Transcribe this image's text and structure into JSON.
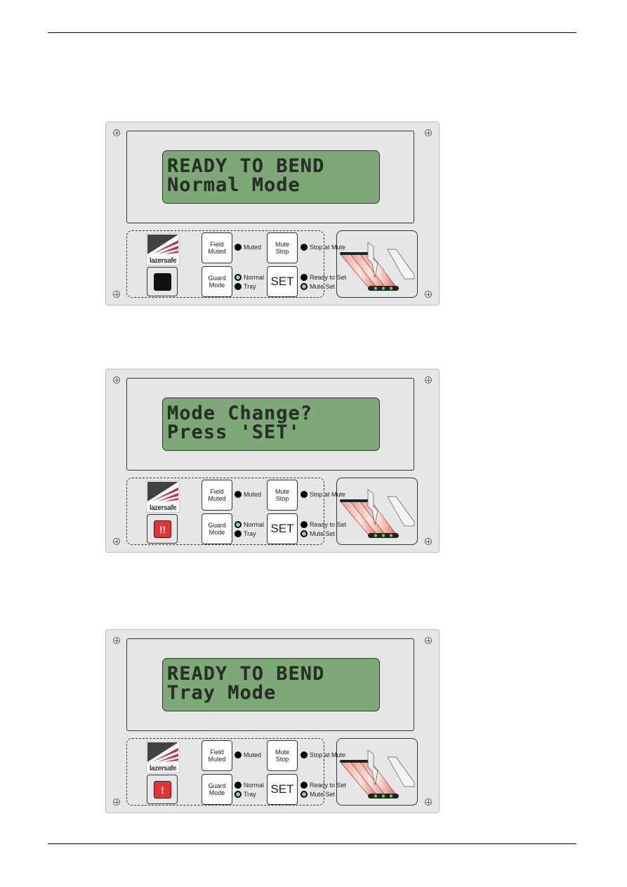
{
  "page": {
    "header_rule": true,
    "footer_rule": true
  },
  "brand": {
    "logo_text": "lazersafe",
    "logo_colors": {
      "dark": "#3f4440",
      "red": "#d8242f"
    }
  },
  "colors": {
    "lcd": "#7fa878",
    "panel": "#e6e6e6",
    "led_on": "#7be36e",
    "alarm": "#e53232"
  },
  "panels": [
    {
      "lcd": {
        "line1": "READY TO BEND",
        "line2": "Normal Mode"
      },
      "alarm": {
        "state": "off",
        "symbol": ""
      },
      "buttons": {
        "field_muted": [
          "Field",
          "Muted"
        ],
        "mute_stop": [
          "Mute",
          "Stop"
        ],
        "guard_mode": [
          "Guard",
          "Mode"
        ],
        "set": "SET"
      },
      "indicators": [
        {
          "label": "Muted",
          "on": false
        },
        {
          "label": "Stop at Mute",
          "on": false
        },
        {
          "label": "Normal",
          "on": true
        },
        {
          "label": "Tray",
          "on": false
        },
        {
          "label": "Ready to Set",
          "on": false
        },
        {
          "label": "Mute Set",
          "on": true
        }
      ]
    },
    {
      "lcd": {
        "line1": "Mode Change?",
        "line2": "Press 'SET'"
      },
      "alarm": {
        "state": "on",
        "symbol": "!!"
      },
      "buttons": {
        "field_muted": [
          "Field",
          "Muted"
        ],
        "mute_stop": [
          "Mute",
          "Stop"
        ],
        "guard_mode": [
          "Guard",
          "Mode"
        ],
        "set": "SET"
      },
      "indicators": [
        {
          "label": "Muted",
          "on": false
        },
        {
          "label": "Stop at Mute",
          "on": false
        },
        {
          "label": "Normal",
          "on": true
        },
        {
          "label": "Tray",
          "on": false
        },
        {
          "label": "Ready to Set",
          "on": false
        },
        {
          "label": "Mute Set",
          "on": true
        }
      ]
    },
    {
      "lcd": {
        "line1": "READY TO BEND",
        "line2": "Tray Mode"
      },
      "alarm": {
        "state": "on",
        "symbol": "!"
      },
      "buttons": {
        "field_muted": [
          "Field",
          "Muted"
        ],
        "mute_stop": [
          "Mute",
          "Stop"
        ],
        "guard_mode": [
          "Guard",
          "Mode"
        ],
        "set": "SET"
      },
      "indicators": [
        {
          "label": "Muted",
          "on": false
        },
        {
          "label": "Stop at Mute",
          "on": false
        },
        {
          "label": "Normal",
          "on": false
        },
        {
          "label": "Tray",
          "on": true
        },
        {
          "label": "Ready to Set",
          "on": false
        },
        {
          "label": "Mute Set",
          "on": true
        }
      ]
    }
  ]
}
